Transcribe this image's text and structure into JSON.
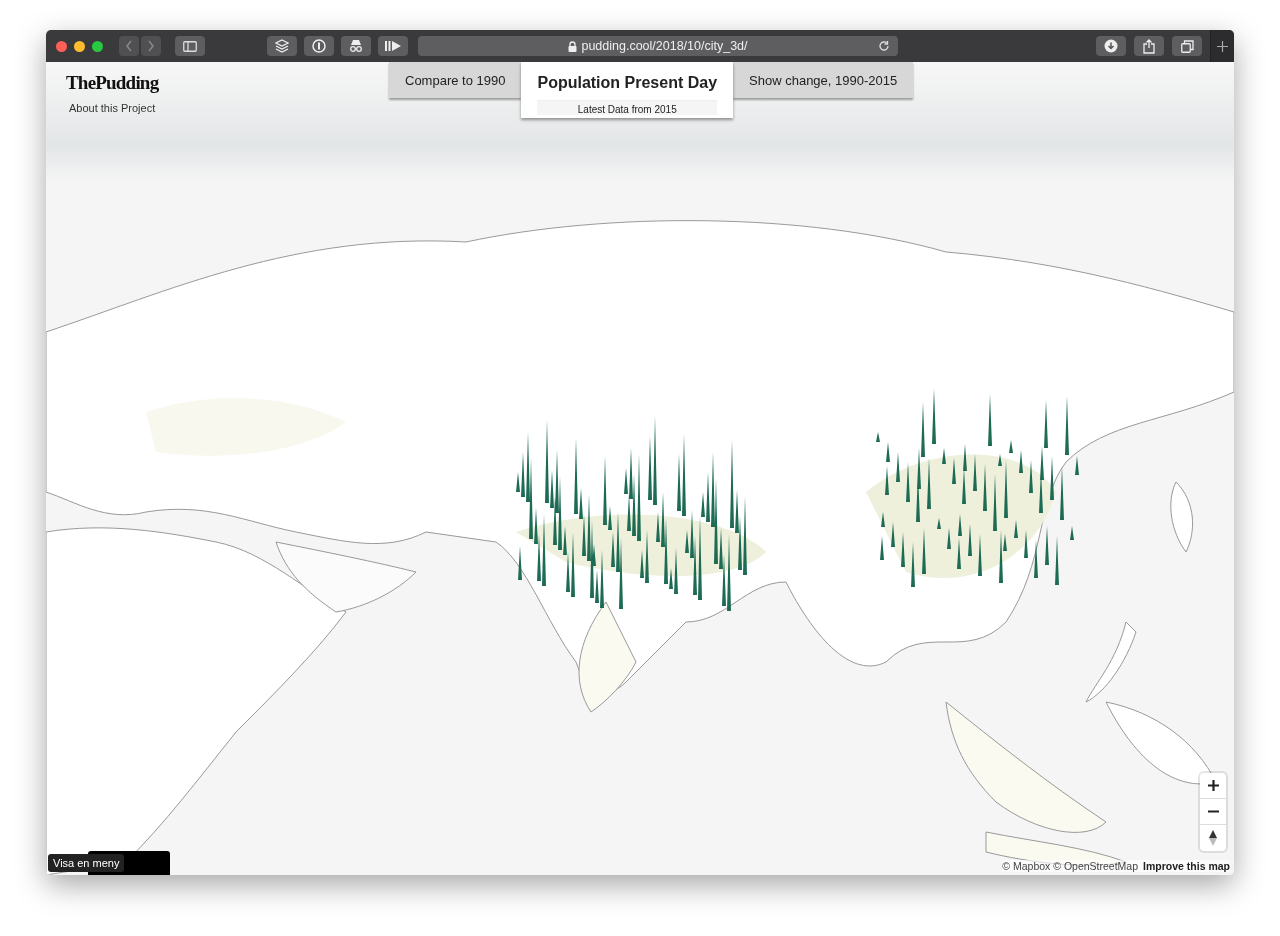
{
  "browser": {
    "url": "pudding.cool/2018/10/city_3d/"
  },
  "header": {
    "logo": "ThePudding",
    "about_link": "About this Project"
  },
  "tabs": [
    {
      "label": "Compare to 1990",
      "selected": false
    },
    {
      "label": "Population Present Day",
      "subtitle": "Latest Data from 2015",
      "selected": true
    },
    {
      "label": "Show change, 1990-2015",
      "selected": false
    }
  ],
  "attribution": {
    "sources": "© Mapbox © OpenStreetMap",
    "link": "Improve this map"
  },
  "tooltip": "Visa en meny"
}
